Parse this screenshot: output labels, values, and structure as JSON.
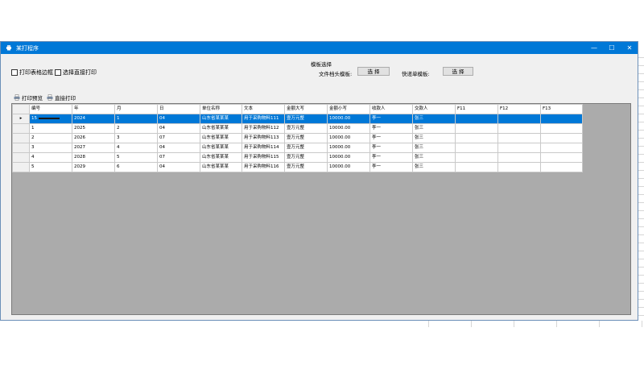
{
  "window": {
    "title": "某打程序",
    "controls": {
      "minimize": "—",
      "maximize": "☐",
      "close": "✕"
    }
  },
  "options": {
    "print_edge_label": "打印表格边框",
    "pdf_direct_label": "选择直接打印"
  },
  "template_group": {
    "label": "模板选择",
    "file_template_label": "文件档头模板:",
    "file_template_button": "选 择",
    "single_template_label": "快递单模板:",
    "single_template_button": "选 择"
  },
  "toolbar": {
    "print_preview": "打印预览",
    "direct_print": "直接打印"
  },
  "grid": {
    "columns": [
      "编号",
      "年",
      "月",
      "日",
      "单位名称",
      "文本",
      "金额大写",
      "金额小写",
      "收款人",
      "交款人",
      "F11",
      "F12",
      "F13"
    ],
    "rows": [
      {
        "marker": "▸",
        "cells": [
          "15",
          "2024",
          "1",
          "04",
          "山东省某某某",
          "用于采购物料111",
          "壹万元整",
          "10000.00",
          "李一",
          "张三",
          "",
          "",
          ""
        ]
      },
      {
        "marker": "",
        "cells": [
          "1",
          "2025",
          "2",
          "04",
          "山东省某某某",
          "用于采购物料112",
          "壹万元整",
          "10000.00",
          "李一",
          "张三",
          "",
          "",
          ""
        ]
      },
      {
        "marker": "",
        "cells": [
          "2",
          "2026",
          "3",
          "07",
          "山东省某某某",
          "用于采购物料113",
          "壹万元整",
          "10000.00",
          "李一",
          "张三",
          "",
          "",
          ""
        ]
      },
      {
        "marker": "",
        "cells": [
          "3",
          "2027",
          "4",
          "04",
          "山东省某某某",
          "用于采购物料114",
          "壹万元整",
          "10000.00",
          "李一",
          "张三",
          "",
          "",
          ""
        ]
      },
      {
        "marker": "",
        "cells": [
          "4",
          "2028",
          "5",
          "07",
          "山东省某某某",
          "用于采购物料115",
          "壹万元整",
          "10000.00",
          "李一",
          "张三",
          "",
          "",
          ""
        ]
      },
      {
        "marker": "",
        "cells": [
          "5",
          "2029",
          "6",
          "04",
          "山东省某某某",
          "用于采购物料116",
          "壹万元整",
          "10000.00",
          "李一",
          "张三",
          "",
          "",
          ""
        ]
      }
    ],
    "selected_row": 0
  },
  "colors": {
    "titlebar": "#0078d7",
    "selection": "#0078d7",
    "grid_empty_area": "#ababab",
    "window_bg": "#f0f0f0"
  },
  "icons": {
    "app": "printer-app-icon",
    "print_preview": "printer-icon",
    "direct_print": "printer-icon"
  }
}
